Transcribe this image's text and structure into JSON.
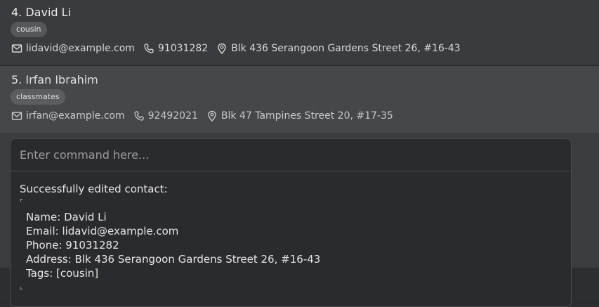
{
  "contacts": [
    {
      "title": "4. David Li",
      "tag": "cousin",
      "email": "lidavid@example.com",
      "phone": "91031282",
      "address": "Blk 436 Serangoon Gardens Street 26, #16-43",
      "icons": [
        "envelope-icon",
        "phone-icon",
        "location-pin-icon"
      ]
    },
    {
      "title": "5. Irfan Ibrahim",
      "tag": "classmates",
      "email": "irfan@example.com",
      "phone": "92492021",
      "address": "Blk 47 Tampines Street 20, #17-35",
      "icons": [
        "envelope-icon",
        "phone-icon",
        "location-pin-icon"
      ]
    }
  ],
  "command": {
    "placeholder": "Enter command here...",
    "value": ""
  },
  "result": {
    "heading": "Successfully edited contact:",
    "open_bracket": "⌜",
    "close_bracket": "⌞",
    "lines": [
      "Name: David Li",
      "Email: lidavid@example.com",
      "Phone: 91031282",
      "Address: Blk 436 Serangoon Gardens Street 26, #16-43",
      "Tags: [cousin]"
    ]
  },
  "colors": {
    "background": "#2b2d30",
    "card_selected": "#45474a",
    "tag_bg": "#55575b",
    "text": "#e6e6e6"
  }
}
